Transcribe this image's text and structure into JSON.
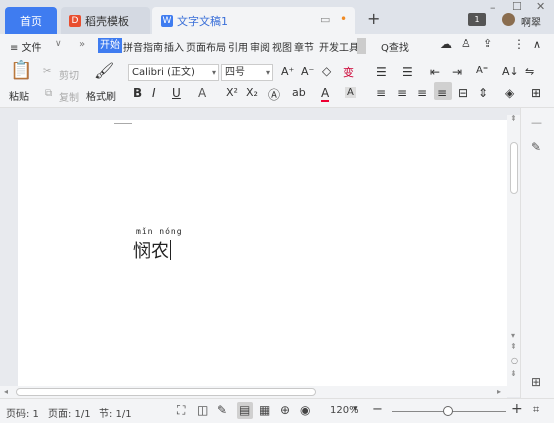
{
  "tabs": {
    "home": "首页",
    "template": "稻壳模板",
    "document": "文字文稿1",
    "new_tab": "+"
  },
  "window": {
    "minimize": "–",
    "maximize": "☐",
    "close": "✕",
    "user_name": "啊翠",
    "badge": "1"
  },
  "menu": {
    "file": "≡ 文件",
    "file_chevron": "∨",
    "more": "»",
    "items": [
      "开始",
      "拼音指南",
      "插入",
      "页面布局",
      "引用",
      "审阅",
      "视图",
      "章节",
      "开发工具"
    ],
    "search": "Q查找",
    "collapse": "∧",
    "kebab": "⋮"
  },
  "ribbon": {
    "paste": "粘贴",
    "cut": "剪切",
    "copy": "复制",
    "format_painter": "格式刷",
    "font": "Calibri (正文)",
    "size": "四号",
    "bold": "B",
    "italic": "I",
    "underline": "U",
    "grow": "A⁺",
    "shrink": "A⁻",
    "superscript": "X²",
    "subscript": "X₂",
    "font_color": "A"
  },
  "document": {
    "pinyin": "mǐn nóng",
    "text": "悯农"
  },
  "status": {
    "page_no": "页码: 1",
    "pages": "页面: 1/1",
    "section": "节: 1/1",
    "zoom": "120%",
    "zoom_out": "−",
    "zoom_in": "+"
  },
  "colors": {
    "accent": "#3f7cf0",
    "tabbar": "#dfe3ea",
    "wps_red": "#e94e2f"
  }
}
